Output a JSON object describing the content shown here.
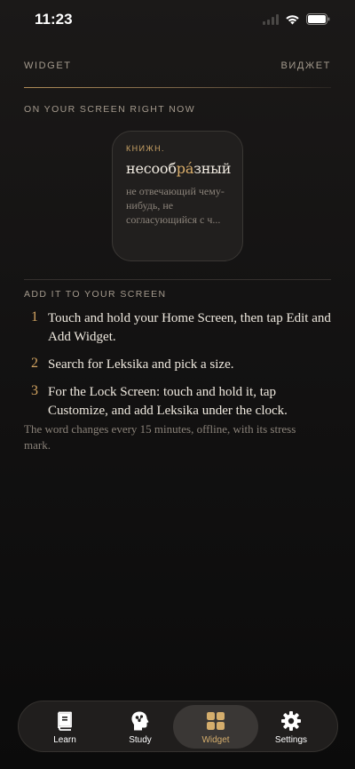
{
  "status_bar": {
    "time": "11:23",
    "icons": [
      "signal-icon",
      "wifi-icon",
      "battery-icon"
    ]
  },
  "header": {
    "left_label": "WIDGET",
    "right_label": "ВИДЖЕТ"
  },
  "preview_section": {
    "label": "ON YOUR SCREEN RIGHT NOW",
    "widget": {
      "tag": "КНИЖН.",
      "word_before": "несооб",
      "word_stress": "ра́",
      "word_after": "зный",
      "definition": "не отвечающий чему-нибудь, не согласующийся с ч..."
    }
  },
  "instructions": {
    "label": "ADD IT TO YOUR SCREEN",
    "steps": [
      {
        "number": "1",
        "text": "Touch and hold your Home Screen, then tap Edit and Add Widget."
      },
      {
        "number": "2",
        "text": "Search for Leksika and pick a size."
      },
      {
        "number": "3",
        "text": "For the Lock Screen: touch and hold it, tap Customize, and add Leksika under the clock."
      }
    ],
    "footnote": "The word changes every 15 minutes, offline, with its stress mark."
  },
  "tab_bar": {
    "active": "Widget",
    "tabs": [
      {
        "label": "Learn",
        "icon": "book-icon"
      },
      {
        "label": "Study",
        "icon": "brain-head-icon"
      },
      {
        "label": "Widget",
        "icon": "widget-grid-icon"
      },
      {
        "label": "Settings",
        "icon": "gear-icon"
      }
    ]
  },
  "colors": {
    "accent": "#d4ad6c",
    "background": "#131212",
    "text": "#ece6dc",
    "muted": "#a49a8d"
  }
}
